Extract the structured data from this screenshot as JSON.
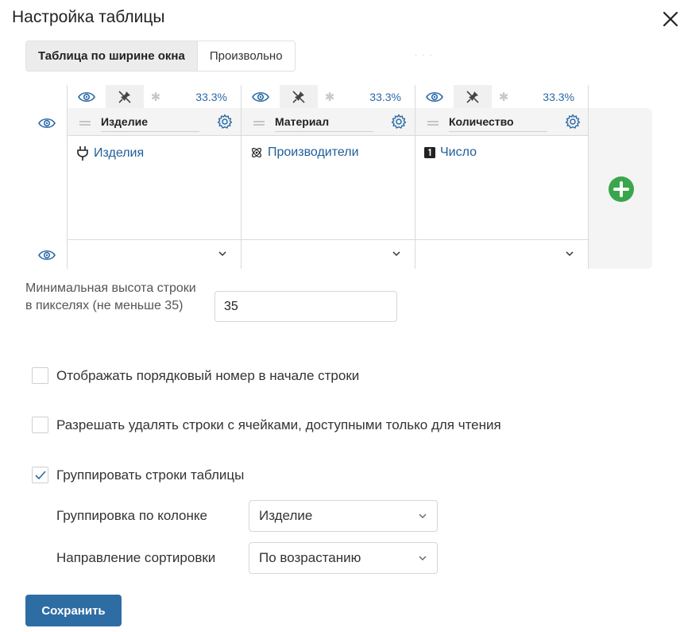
{
  "dialog": {
    "title": "Настройка таблицы"
  },
  "width_mode": {
    "options": [
      "Таблица по ширине окна",
      "Произвольно"
    ],
    "selected": "Таблица по ширине окна"
  },
  "table": {
    "columns": [
      {
        "name": "Изделие",
        "width": "33.3%",
        "type_label": "Изделия",
        "type_icon": "plug-icon",
        "footer_value": ""
      },
      {
        "name": "Материал",
        "width": "33.3%",
        "type_label": "Производители",
        "type_icon": "atom-icon",
        "footer_value": ""
      },
      {
        "name": "Количество",
        "width": "33.3%",
        "type_label": "Число",
        "type_icon": "number-icon",
        "footer_value": ""
      }
    ]
  },
  "min_height": {
    "label": "Минимальная высота строки в пикселях (не меньше 35)",
    "value": "35"
  },
  "options": {
    "show_row_number": {
      "label": "Отображать порядковый номер в начале строки",
      "checked": false
    },
    "allow_delete_readonly": {
      "label": "Разрешать удалять строки с ячейками, доступными только для чтения",
      "checked": false
    },
    "group_rows": {
      "label": "Группировать строки таблицы",
      "checked": true
    }
  },
  "grouping": {
    "column_label": "Группировка по колонке",
    "column_value": "Изделие",
    "sort_label": "Направление сортировки",
    "sort_value": "По возрастанию"
  },
  "save_label": "Сохранить",
  "colors": {
    "accent": "#2e6da4",
    "link": "#1f5e98",
    "add": "#3aa64b"
  }
}
